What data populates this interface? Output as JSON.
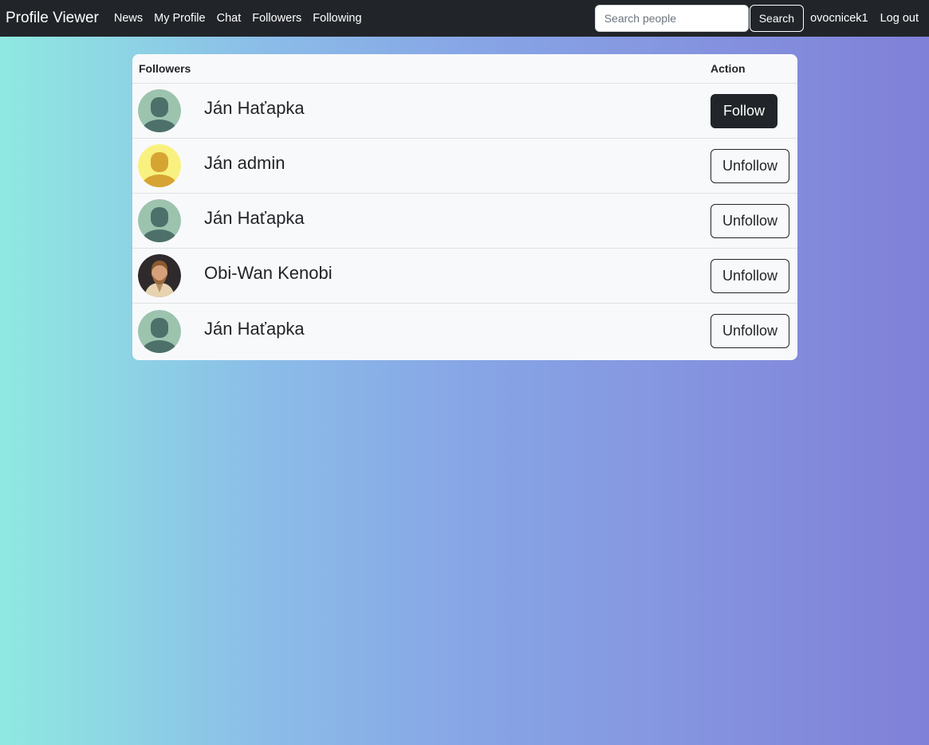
{
  "nav": {
    "brand": "Profile Viewer",
    "links": [
      "News",
      "My Profile",
      "Chat",
      "Followers",
      "Following"
    ],
    "search_placeholder": "Search people",
    "search_button": "Search",
    "username": "ovocnicek1",
    "logout": "Log out"
  },
  "table": {
    "header_followers": "Followers",
    "header_action": "Action",
    "rows": [
      {
        "name": "Ján Haťapka",
        "action": "Follow",
        "avatar": "default-green-avatar"
      },
      {
        "name": "Ján admin",
        "action": "Unfollow",
        "avatar": "default-yellow-avatar"
      },
      {
        "name": "Ján Haťapka",
        "action": "Unfollow",
        "avatar": "default-green-avatar"
      },
      {
        "name": "Obi-Wan Kenobi",
        "action": "Unfollow",
        "avatar": "photo-avatar"
      },
      {
        "name": "Ján Haťapka",
        "action": "Unfollow",
        "avatar": "default-green-avatar"
      }
    ]
  },
  "colors": {
    "navbar": "#212529",
    "card": "#f8f9fa",
    "avatar_green_bg": "#9cc3ae",
    "avatar_green_fg": "#4d706a",
    "avatar_yellow_bg": "#f9f17f",
    "avatar_yellow_fg": "#d6a432"
  }
}
